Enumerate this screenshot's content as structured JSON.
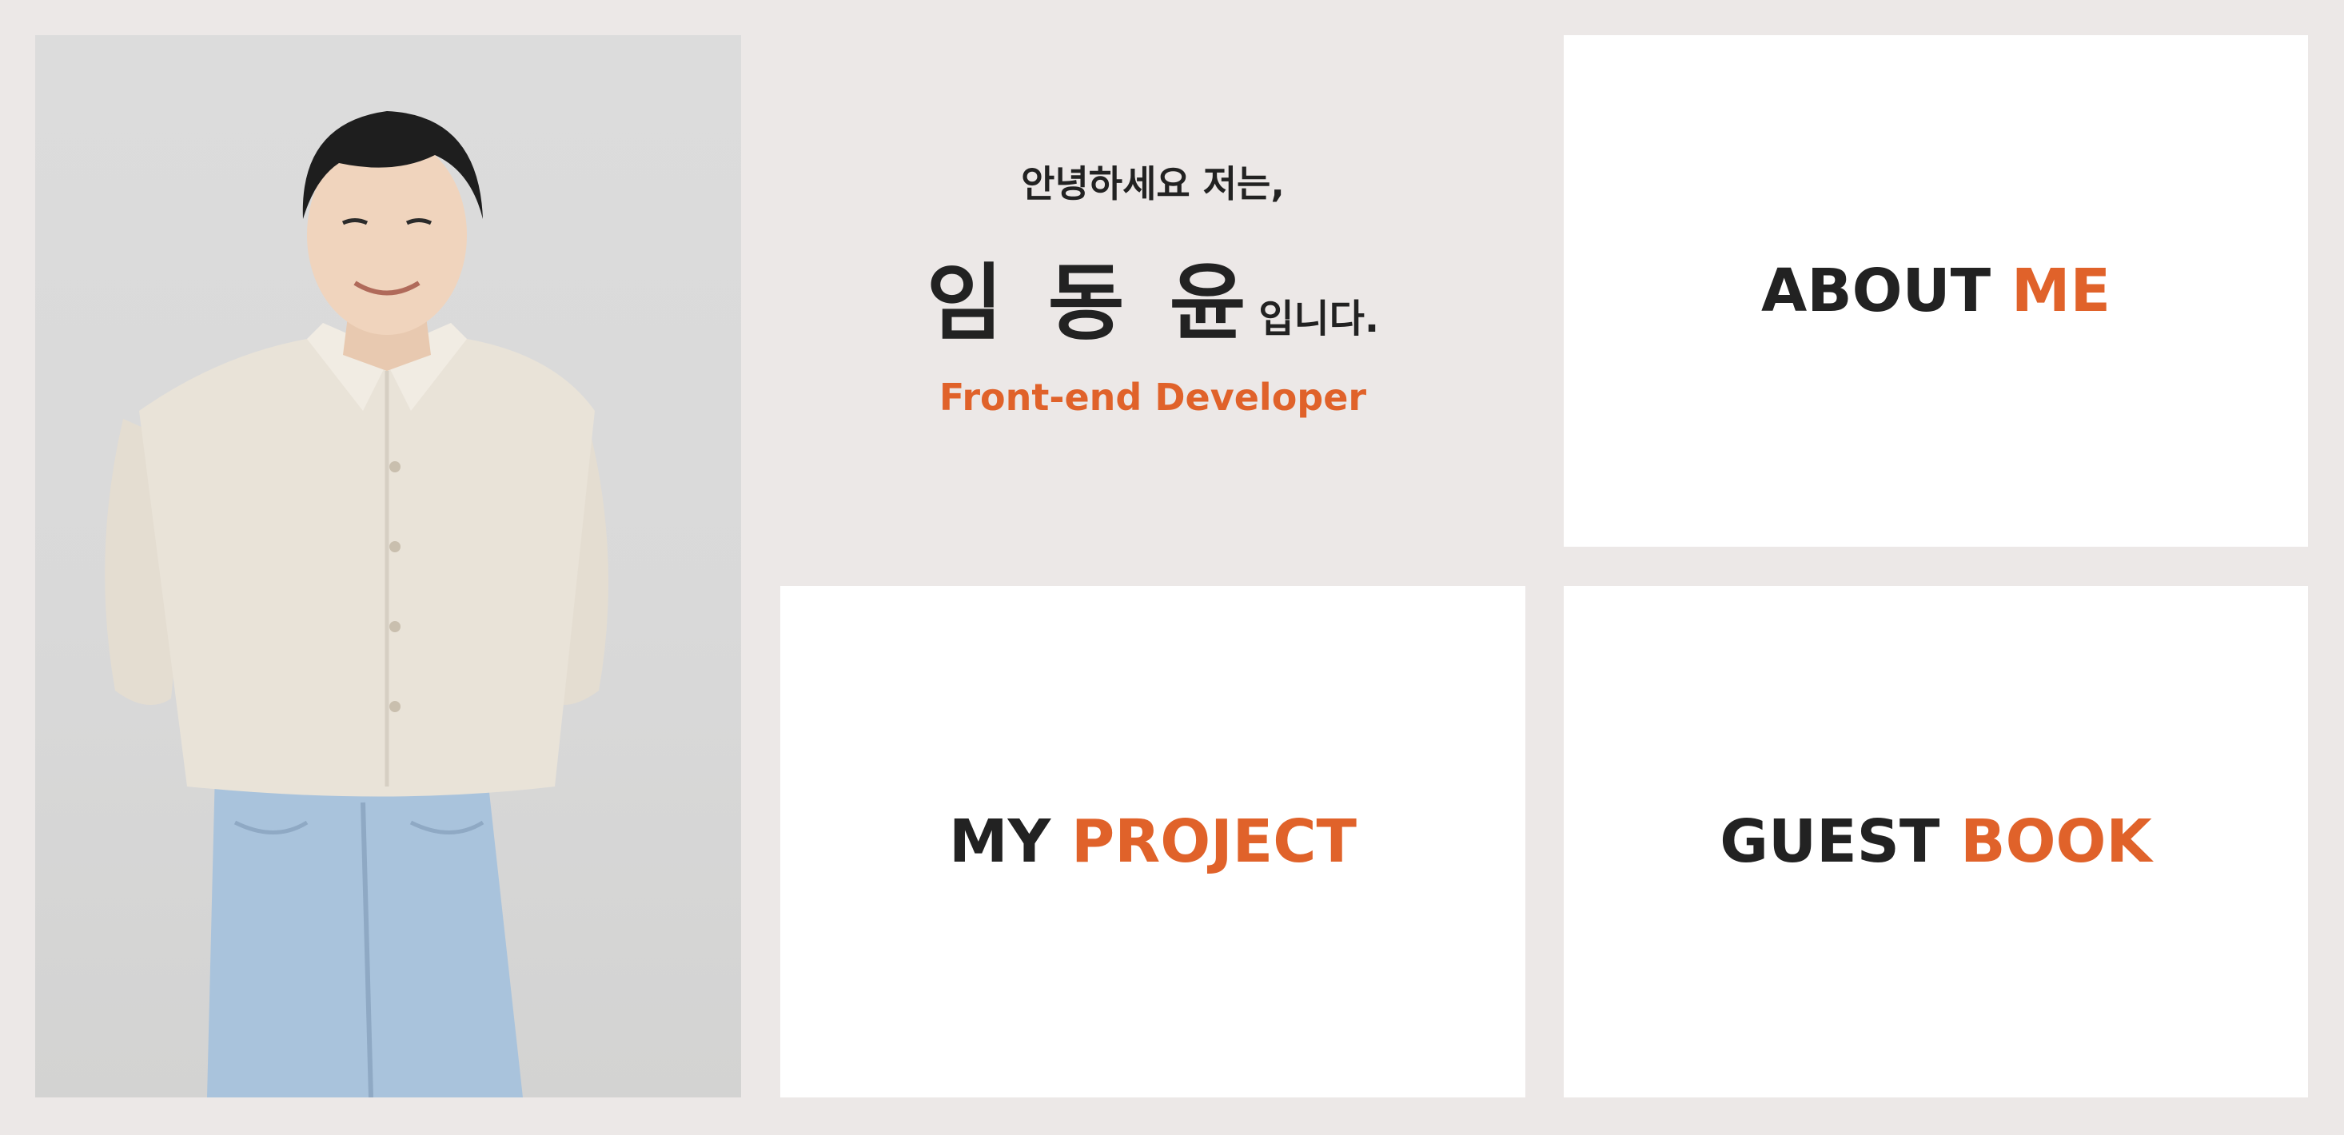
{
  "intro": {
    "greeting": "안녕하세요 저는,",
    "name": "임 동 윤",
    "name_suffix": "입니다.",
    "role": "Front-end Developer"
  },
  "cards": {
    "about": {
      "word": "ABOUT",
      "accent": "ME"
    },
    "project": {
      "word": "MY",
      "accent": "PROJECT"
    },
    "guestbook": {
      "word": "GUEST",
      "accent": "BOOK"
    }
  },
  "colors": {
    "background": "#ece8e7",
    "card": "#ffffff",
    "text": "#222222",
    "accent": "#e0622a"
  }
}
